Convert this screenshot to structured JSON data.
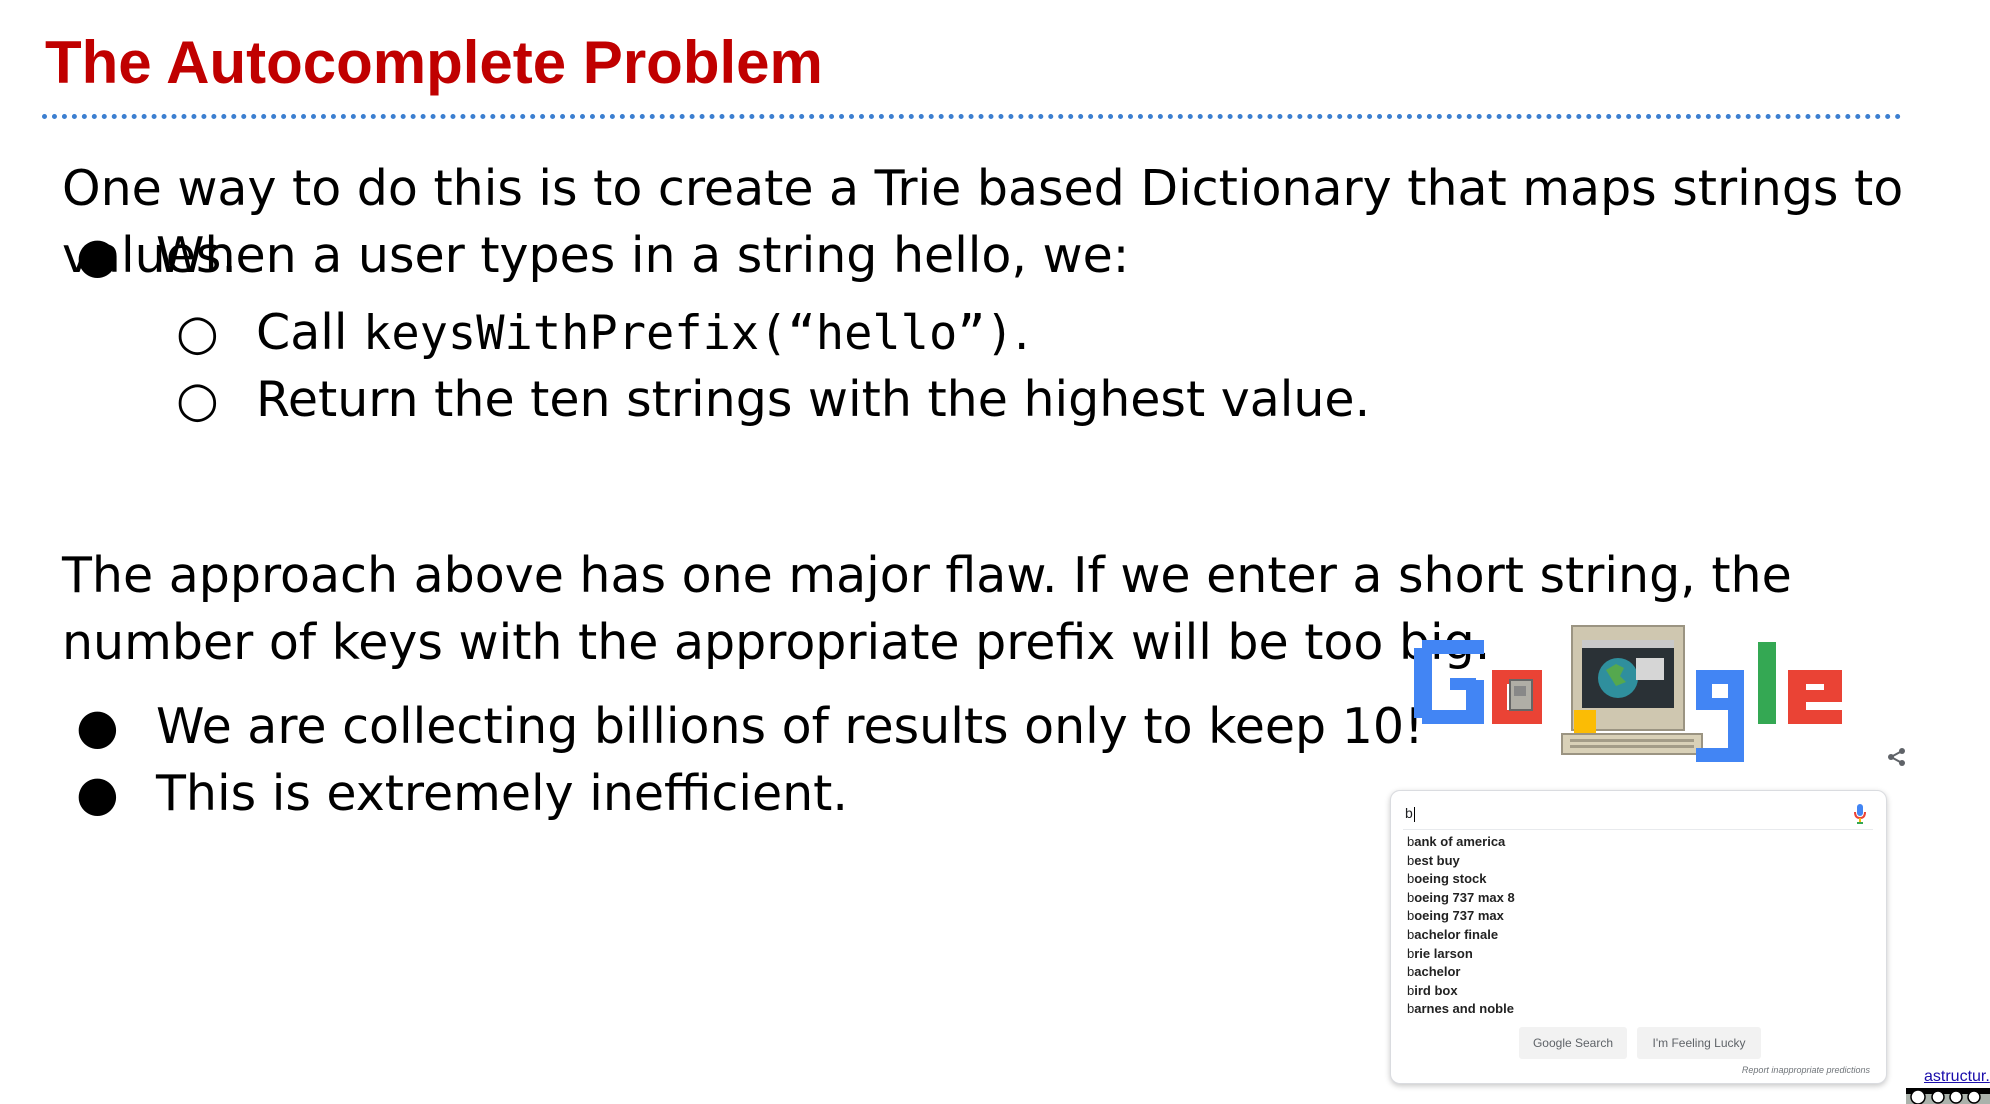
{
  "slide": {
    "title": "The Autocomplete Problem",
    "intro": "One way to do this is to create a Trie based Dictionary that maps strings to values.",
    "bullet1": "When a user types in a string hello, we:",
    "sub1_prefix": "Call ",
    "sub1_code": "keysWithPrefix(“hello”)",
    "sub1_suffix": ".",
    "sub2": "Return the ten strings with the highest value.",
    "flaw": "The approach above has one major flaw. If we enter a short string, the number of keys with the appropriate prefix will be too big.",
    "bullet2": "We are collecting billions of results only to keep 10!",
    "bullet3": "This is extremely inefficient.",
    "bullet_glyph": "●",
    "sub_bullet_glyph": "○",
    "accent_color": "#c00000",
    "rule_color": "#3c7fd0"
  },
  "doodle": {
    "letters": [
      "G",
      "o",
      "o",
      "g",
      "l",
      "e"
    ],
    "colors": [
      "#4285f4",
      "#ea4335",
      "#fbbc05",
      "#4285f4",
      "#34a853",
      "#ea4335"
    ],
    "icon": "computer-globe-doodle"
  },
  "search": {
    "query": "b",
    "icons": {
      "mic": "mic-icon",
      "share": "share-icon"
    },
    "suggestions": [
      {
        "typed": "b",
        "rest": "ank of america"
      },
      {
        "typed": "b",
        "rest": "est buy"
      },
      {
        "typed": "b",
        "rest": "oeing stock"
      },
      {
        "typed": "b",
        "rest": "oeing 737 max 8"
      },
      {
        "typed": "b",
        "rest": "oeing 737 max"
      },
      {
        "typed": "b",
        "rest": "achelor finale"
      },
      {
        "typed": "b",
        "rest": "rie larson"
      },
      {
        "typed": "b",
        "rest": "achelor"
      },
      {
        "typed": "b",
        "rest": "ird box"
      },
      {
        "typed": "b",
        "rest": "arnes and noble"
      }
    ],
    "search_button": "Google Search",
    "lucky_button": "I'm Feeling Lucky",
    "report_link": "Report inappropriate predictions"
  },
  "footer": {
    "link_text": "astructur.",
    "license_badge": "cc-by-nc-sa-badge"
  }
}
